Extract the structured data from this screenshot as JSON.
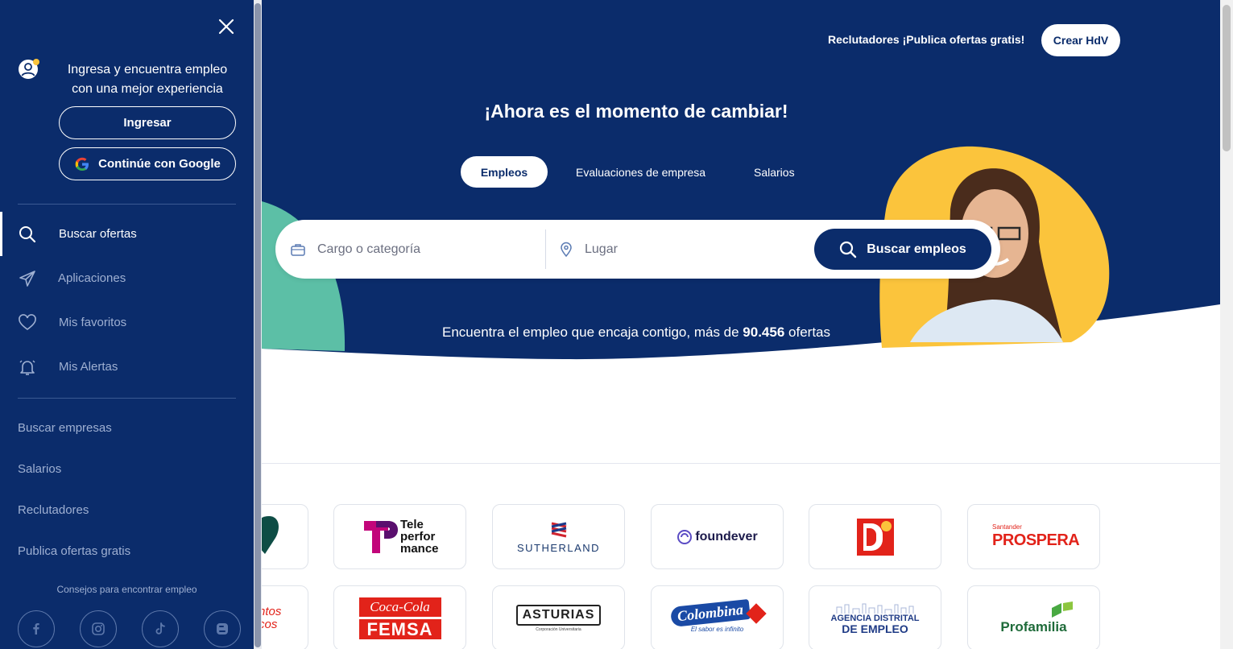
{
  "header": {
    "recruiters_link": "Reclutadores ¡Publica ofertas gratis!",
    "create_cv_button": "Crear HdV"
  },
  "hero": {
    "title": "¡Ahora es el momento de cambiar!",
    "tabs": [
      {
        "label": "Empleos",
        "active": true
      },
      {
        "label": "Evaluaciones de empresa",
        "active": false
      },
      {
        "label": "Salarios",
        "active": false
      }
    ],
    "search": {
      "job_placeholder": "Cargo o categoría",
      "job_icon": "briefcase-icon",
      "location_placeholder": "Lugar",
      "location_icon": "map-pin-icon",
      "button_label": "Buscar empleos"
    },
    "subtitle_prefix": "Encuentra el empleo que encaja contigo, más de ",
    "subtitle_count": "90.456",
    "subtitle_suffix": " ofertas"
  },
  "companies": {
    "row1": [
      {
        "name": "Teleperformance",
        "text": "Tele perfor mance"
      },
      {
        "name": "Sutherland",
        "text": "SUTHERLAND"
      },
      {
        "name": "Foundever",
        "text": "foundever"
      },
      {
        "name": "D1",
        "text": "D1"
      },
      {
        "name": "Santander Prospera",
        "top": "Santander",
        "text": "PROSPERA"
      }
    ],
    "row2": [
      {
        "name": "Coca-Cola FEMSA",
        "top": "Coca-Cola",
        "text": "FEMSA"
      },
      {
        "name": "Asturias",
        "text": "ASTURIAS",
        "sub": "Corporación Universitaria"
      },
      {
        "name": "Colombina",
        "text": "Colombina",
        "sub": "El sabor es infinito"
      },
      {
        "name": "Agencia Distrital de Empleo",
        "top": "AGENCIA DISTRITAL",
        "text": "DE EMPLEO"
      },
      {
        "name": "Profamilia",
        "text": "Profamilia"
      }
    ],
    "partial_row2_text": "ntos cos"
  },
  "drawer": {
    "login_message": "Ingresa y encuentra empleo con una mejor experiencia",
    "login_button": "Ingresar",
    "google_button": "Continúe con Google",
    "nav": [
      {
        "label": "Buscar ofertas",
        "icon": "search-icon",
        "active": true
      },
      {
        "label": "Aplicaciones",
        "icon": "send-icon",
        "active": false
      },
      {
        "label": "Mis favoritos",
        "icon": "heart-icon",
        "active": false
      },
      {
        "label": "Mis Alertas",
        "icon": "bell-icon",
        "active": false
      }
    ],
    "links": [
      "Buscar empresas",
      "Salarios",
      "Reclutadores",
      "Publica ofertas gratis"
    ],
    "tips_label": "Consejos para encontrar empleo",
    "social": [
      "facebook-icon",
      "instagram-icon",
      "tiktok-icon",
      "blog-icon"
    ]
  },
  "colors": {
    "navy": "#0b2c6b",
    "yellow": "#fbc43c",
    "teal": "#5cbfa6"
  }
}
